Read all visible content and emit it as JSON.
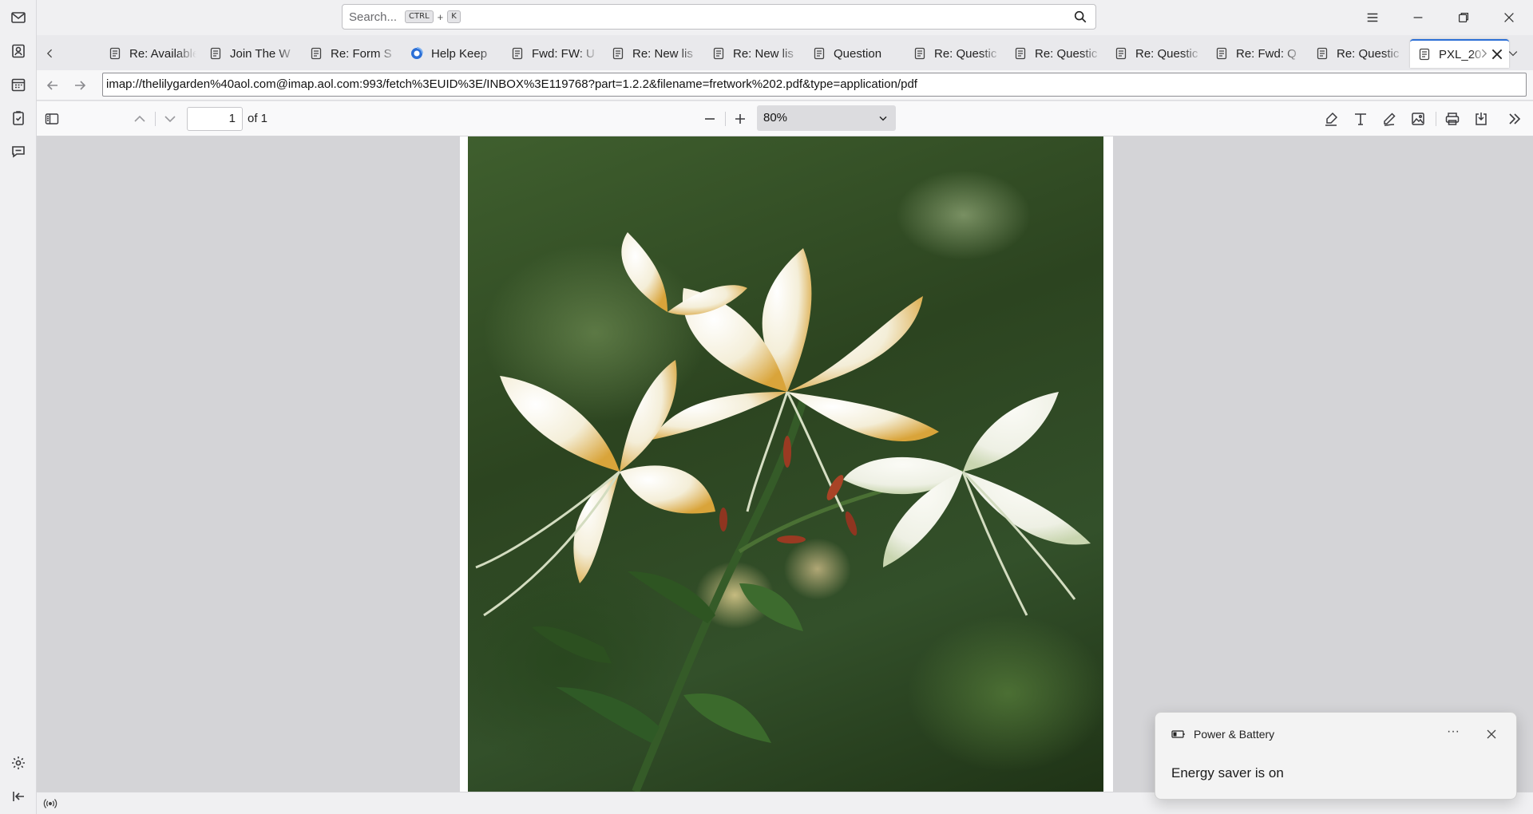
{
  "spaces": {
    "items": [
      "mail-icon",
      "address-book-icon",
      "calendar-icon",
      "tasks-icon",
      "chat-icon"
    ],
    "bottom": [
      "settings-icon",
      "collapse-icon"
    ]
  },
  "titlebar": {
    "search_placeholder": "Search...",
    "shortcut_key1": "CTRL",
    "shortcut_plus": "+",
    "shortcut_key2": "K"
  },
  "tabs": [
    {
      "label": "Re: Available",
      "icon": "message-icon"
    },
    {
      "label": "Join The W",
      "icon": "message-icon"
    },
    {
      "label": "Re: Form S",
      "icon": "message-icon"
    },
    {
      "label": "Help Keep",
      "icon": "browser-icon"
    },
    {
      "label": "Fwd: FW: U",
      "icon": "message-icon"
    },
    {
      "label": "Re: New lis",
      "icon": "message-icon"
    },
    {
      "label": "Re: New lis",
      "icon": "message-icon"
    },
    {
      "label": "Question",
      "icon": "message-icon"
    },
    {
      "label": "Re: Questic",
      "icon": "message-icon"
    },
    {
      "label": "Re: Questic",
      "icon": "message-icon"
    },
    {
      "label": "Re: Questic",
      "icon": "message-icon"
    },
    {
      "label": "Re: Fwd: Q",
      "icon": "message-icon"
    },
    {
      "label": "Re: Questic",
      "icon": "message-icon"
    },
    {
      "label": "PXL_20",
      "icon": "message-icon",
      "active": true
    }
  ],
  "urlbar": {
    "url": "imap://thelilygarden%40aol.com@imap.aol.com:993/fetch%3EUID%3E/INBOX%3E119768?part=1.2.2&filename=fretwork%202.pdf&type=application/pdf"
  },
  "pdf": {
    "page_number": "1",
    "page_count_label": "of 1",
    "zoom": "80%"
  },
  "toast": {
    "title": "Power & Battery",
    "more": "···",
    "body": "Energy saver is on"
  },
  "colors": {
    "accent": "#2b6fd6",
    "viewer_bg": "#d4d4d7"
  }
}
